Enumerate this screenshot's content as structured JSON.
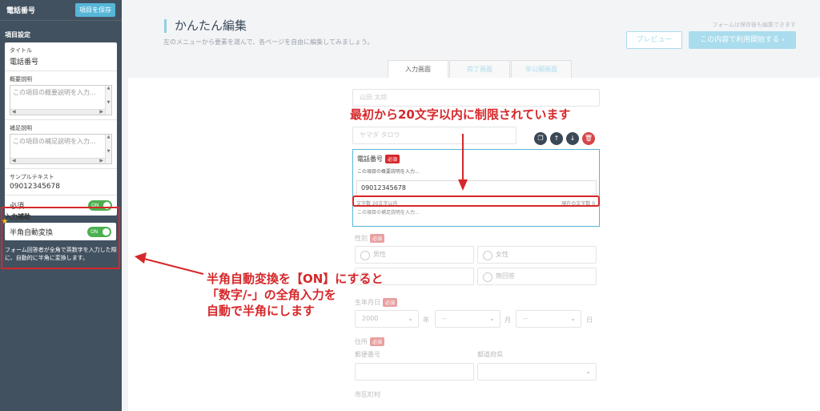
{
  "sidebar": {
    "title": "電話番号",
    "save_label": "項目を保存",
    "section_settings": "項目設定",
    "title_label": "タイトル",
    "title_value": "電話番号",
    "summary_label": "概要説明",
    "summary_placeholder": "この項目の概要説明を入力...",
    "note_label": "補足説明",
    "note_placeholder": "この項目の補足説明を入力...",
    "sample_label": "サンプルテキスト",
    "sample_value": "09012345678",
    "required_label": "必須",
    "toggle_on": "ON",
    "section_assist": "入力補助",
    "auto_convert_label": "半角自動変換",
    "assist_desc": "フォーム回答者が全角で英数字を入力した際に、自動的に半角に変換します。"
  },
  "header": {
    "title": "かんたん編集",
    "subtitle": "左のメニューから要素を選んで、各ページを自由に編集してみましょう。",
    "note": "フォームは保存後も編集できます",
    "preview_label": "プレビュー",
    "start_label": "この内容で利用開始する ›"
  },
  "tabs": [
    "入力画面",
    "完了画面",
    "非公開画面"
  ],
  "form": {
    "name_placeholder": "山田 太郎",
    "kana_placeholder": "ヤマダ タロウ",
    "phone": {
      "title": "電話番号",
      "required": "必須",
      "desc": "この項目の概要説明を入力...",
      "value": "09012345678",
      "count_left": "文字数 20文字以内",
      "count_right": "現在の文字数 0",
      "hint": "この項目の補足説明を入力..."
    },
    "gender_label": "性別",
    "gender_options": [
      "男性",
      "女性",
      "",
      "無回答"
    ],
    "birth_label": "生年月日",
    "birth_year": "2000",
    "birth_month": "--",
    "birth_day": "--",
    "unit_year": "年",
    "unit_month": "月",
    "unit_day": "日",
    "address_label": "住所",
    "zip_label": "郵便番号",
    "pref_label": "都道府県",
    "city_label": "市区町村"
  },
  "annotations": {
    "top": "最初から20文字以内に制限されています",
    "bottom_1": "半角自動変換を【ON】にすると",
    "bottom_2": "「数字/-」の全角入力を",
    "bottom_3": "自動で半角にします"
  }
}
